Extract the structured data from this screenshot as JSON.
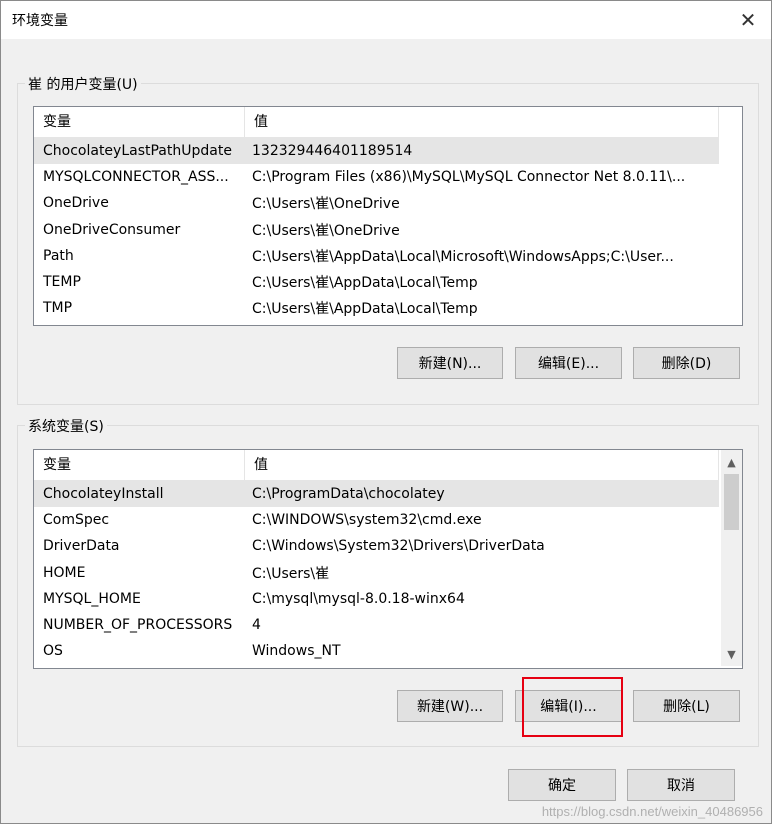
{
  "window": {
    "title": "环境变量",
    "close_glyph": "✕"
  },
  "user_vars": {
    "group_label": "崔 的用户变量(U)",
    "columns": [
      "变量",
      "值"
    ],
    "rows": [
      {
        "name": "ChocolateyLastPathUpdate",
        "value": "132329446401189514"
      },
      {
        "name": "MYSQLCONNECTOR_ASS...",
        "value": "C:\\Program Files (x86)\\MySQL\\MySQL Connector Net 8.0.11\\..."
      },
      {
        "name": "OneDrive",
        "value": "C:\\Users\\崔\\OneDrive"
      },
      {
        "name": "OneDriveConsumer",
        "value": "C:\\Users\\崔\\OneDrive"
      },
      {
        "name": "Path",
        "value": "C:\\Users\\崔\\AppData\\Local\\Microsoft\\WindowsApps;C:\\User..."
      },
      {
        "name": "TEMP",
        "value": "C:\\Users\\崔\\AppData\\Local\\Temp"
      },
      {
        "name": "TMP",
        "value": "C:\\Users\\崔\\AppData\\Local\\Temp"
      }
    ],
    "buttons": {
      "new": "新建(N)...",
      "edit": "编辑(E)...",
      "delete": "删除(D)"
    }
  },
  "system_vars": {
    "group_label": "系统变量(S)",
    "columns": [
      "变量",
      "值"
    ],
    "rows": [
      {
        "name": "ChocolateyInstall",
        "value": "C:\\ProgramData\\chocolatey"
      },
      {
        "name": "ComSpec",
        "value": "C:\\WINDOWS\\system32\\cmd.exe"
      },
      {
        "name": "DriverData",
        "value": "C:\\Windows\\System32\\Drivers\\DriverData"
      },
      {
        "name": "HOME",
        "value": "C:\\Users\\崔"
      },
      {
        "name": "MYSQL_HOME",
        "value": "C:\\mysql\\mysql-8.0.18-winx64"
      },
      {
        "name": "NUMBER_OF_PROCESSORS",
        "value": "4"
      },
      {
        "name": "OS",
        "value": "Windows_NT"
      }
    ],
    "buttons": {
      "new": "新建(W)...",
      "edit": "编辑(I)...",
      "delete": "删除(L)"
    }
  },
  "footer": {
    "ok": "确定",
    "cancel": "取消"
  },
  "watermark": "https://blog.csdn.net/weixin_40486956",
  "colors": {
    "highlight": "#e60012",
    "selected_row": "#e5e5e5"
  }
}
